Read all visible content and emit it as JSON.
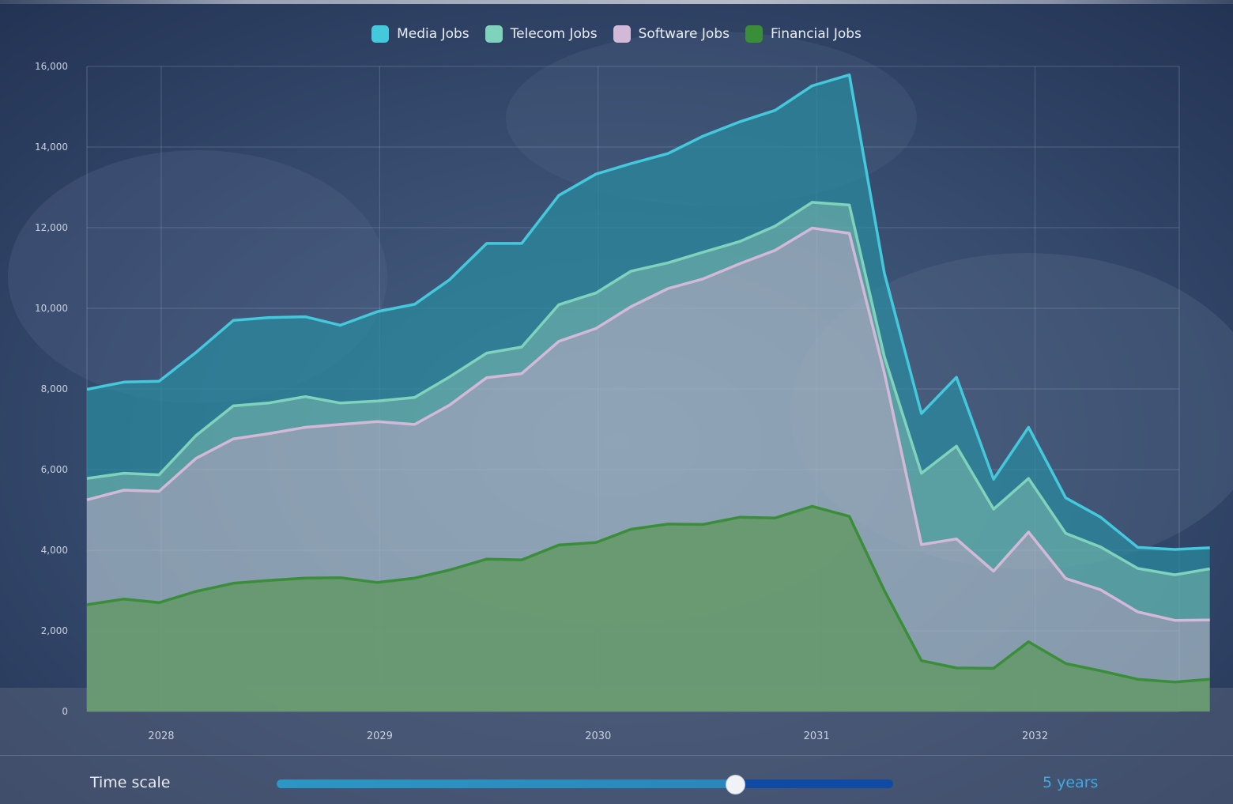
{
  "legend": [
    {
      "label": "Media Jobs",
      "color": "#44c9dc"
    },
    {
      "label": "Telecom Jobs",
      "color": "#7fd3bc"
    },
    {
      "label": "Software Jobs",
      "color": "#d3b9d8"
    },
    {
      "label": "Financial Jobs",
      "color": "#3a8e3a"
    }
  ],
  "chart_data": {
    "type": "area",
    "stacked": true,
    "grid": true,
    "legend_position": "top-center",
    "ylim": [
      0,
      16000
    ],
    "y_ticks": [
      "0",
      "2,000",
      "4,000",
      "6,000",
      "8,000",
      "10,000",
      "12,000",
      "14,000",
      "16,000"
    ],
    "x_ticks": [
      "2028",
      "2029",
      "2030",
      "2031",
      "2032"
    ],
    "x_tick_values": [
      2028,
      2029,
      2030,
      2031,
      2032
    ],
    "x": [
      2027.66,
      2027.83,
      2027.99,
      2028.16,
      2028.33,
      2028.49,
      2028.66,
      2028.82,
      2028.99,
      2029.16,
      2029.32,
      2029.49,
      2029.65,
      2029.82,
      2029.99,
      2030.15,
      2030.32,
      2030.48,
      2030.65,
      2030.81,
      2030.98,
      2031.15,
      2031.31,
      2031.48,
      2031.64,
      2031.81,
      2031.97,
      2032.14,
      2032.3,
      2032.47,
      2032.64,
      2032.8
    ],
    "xlim": [
      2027.66,
      2032.66
    ],
    "series": [
      {
        "name": "Financial Jobs",
        "color": "#3a8e3a",
        "values": [
          2650,
          2790,
          2700,
          2980,
          3180,
          3250,
          3310,
          3320,
          3200,
          3310,
          3510,
          3780,
          3760,
          4130,
          4190,
          4520,
          4650,
          4640,
          4820,
          4800,
          5090,
          4840,
          3000,
          1260,
          1080,
          1070,
          1730,
          1190,
          1010,
          800,
          730,
          800
        ]
      },
      {
        "name": "Software Jobs",
        "color": "#d3b9d8",
        "values": [
          2600,
          2700,
          2760,
          3300,
          3580,
          3640,
          3740,
          3800,
          3990,
          3810,
          4090,
          4500,
          4620,
          5050,
          5310,
          5520,
          5840,
          6090,
          6290,
          6640,
          6900,
          7020,
          5400,
          2880,
          3200,
          2410,
          2720,
          2110,
          2010,
          1670,
          1530,
          1470
        ]
      },
      {
        "name": "Telecom Jobs",
        "color": "#7fd3bc",
        "values": [
          530,
          420,
          410,
          570,
          820,
          760,
          760,
          530,
          510,
          670,
          700,
          610,
          660,
          910,
          880,
          880,
          640,
          660,
          550,
          600,
          640,
          700,
          400,
          1770,
          2300,
          1540,
          1330,
          1120,
          1060,
          1080,
          1130,
          1270
        ]
      },
      {
        "name": "Media Jobs",
        "color": "#44c9dc",
        "values": [
          2210,
          2260,
          2320,
          2060,
          2120,
          2120,
          1980,
          1930,
          2220,
          2310,
          2410,
          2720,
          2570,
          2710,
          2950,
          2670,
          2710,
          2880,
          2970,
          2870,
          2890,
          3230,
          2070,
          1480,
          1710,
          740,
          1270,
          880,
          740,
          520,
          630,
          520
        ]
      }
    ]
  },
  "footer": {
    "time_scale_label": "Time scale",
    "slider_position_fraction": 0.743,
    "time_scale_value": "5 years"
  }
}
